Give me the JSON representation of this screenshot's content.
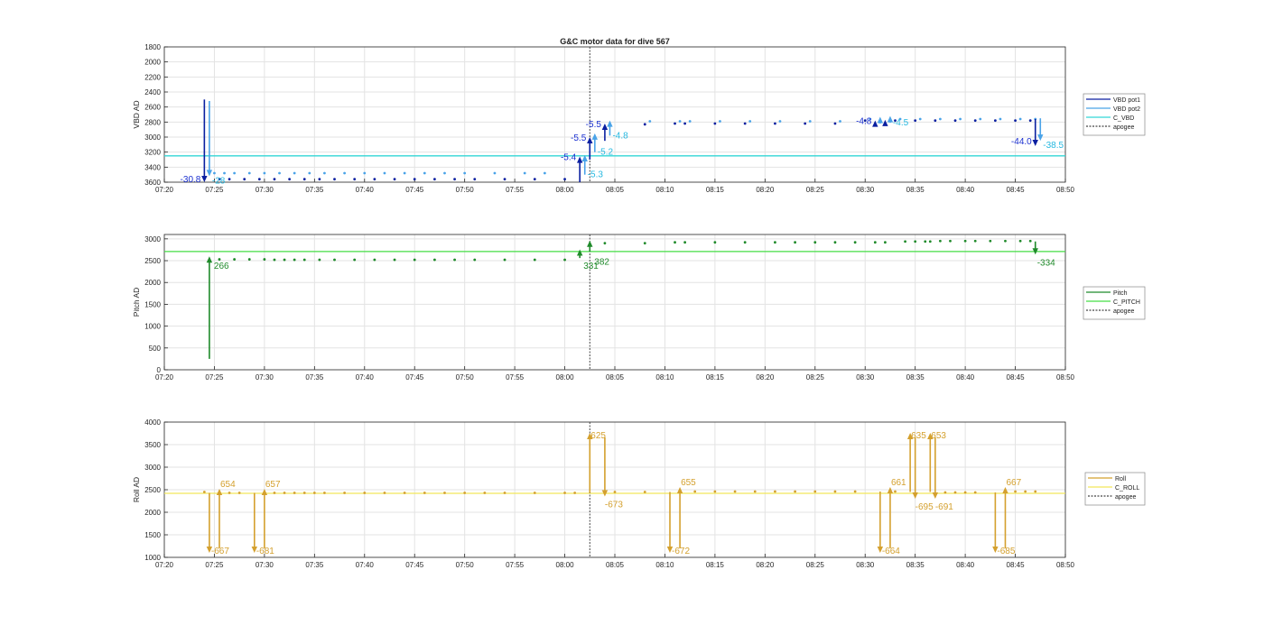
{
  "title": "G&C motor data for dive 567",
  "colors": {
    "vbd_pot1": "#0a1fa0",
    "vbd_pot2": "#4aa3e8",
    "c_vbd": "#33d6d6",
    "vbd_label1": "#1a2fd0",
    "vbd_label2": "#26b8e0",
    "pitch": "#1f8a2a",
    "c_pitch": "#44dd44",
    "roll": "#d4a02e",
    "c_roll": "#f2e85a",
    "apogee": "#444444",
    "grid": "#e3e3e3",
    "axis": "#262626"
  },
  "chart_data": [
    {
      "type": "line",
      "panel": "vbd",
      "title": "G&C motor data for dive 567",
      "xlabel": "",
      "ylabel": "VBD AD",
      "xlim": [
        "07:20",
        "08:50"
      ],
      "ylim": [
        1800,
        3600
      ],
      "y_reversed": true,
      "grid": true,
      "legend_position": "outside-right",
      "xticks": [
        "07:20",
        "07:25",
        "07:30",
        "07:35",
        "07:40",
        "07:45",
        "07:50",
        "07:55",
        "08:00",
        "08:05",
        "08:10",
        "08:15",
        "08:20",
        "08:25",
        "08:30",
        "08:35",
        "08:40",
        "08:45",
        "08:50"
      ],
      "yticks": [
        1800,
        2000,
        2200,
        2400,
        2600,
        2800,
        3000,
        3200,
        3400,
        3600
      ],
      "legend": [
        "VBD pot1",
        "VBD pot2",
        "C_VBD",
        "apogee"
      ],
      "hline": {
        "name": "C_VBD",
        "y": 3250
      },
      "apogee": "08:02.5",
      "series": [
        {
          "name": "VBD pot1",
          "x": [
            "07:25.5",
            "07:26.5",
            "07:28",
            "07:29.5",
            "07:31",
            "07:32.5",
            "07:34",
            "07:35.5",
            "07:37",
            "07:39",
            "07:41",
            "07:43",
            "07:45",
            "07:47",
            "07:49",
            "07:51",
            "07:54",
            "07:57",
            "08:00",
            "08:08",
            "08:11",
            "08:12",
            "08:15",
            "08:18",
            "08:21",
            "08:24",
            "08:27",
            "08:30",
            "08:33",
            "08:35",
            "08:37",
            "08:39",
            "08:41",
            "08:43",
            "08:45",
            "08:46.5"
          ],
          "y": [
            3560,
            3560,
            3560,
            3560,
            3560,
            3560,
            3560,
            3560,
            3560,
            3560,
            3560,
            3560,
            3560,
            3560,
            3560,
            3560,
            3560,
            3560,
            3560,
            2830,
            2820,
            2820,
            2820,
            2820,
            2820,
            2820,
            2820,
            2780,
            2780,
            2780,
            2780,
            2780,
            2780,
            2780,
            2780,
            2780
          ]
        },
        {
          "name": "VBD pot2",
          "x": [
            "07:25",
            "07:26",
            "07:27",
            "07:28.5",
            "07:30",
            "07:31.5",
            "07:33",
            "07:34.5",
            "07:36",
            "07:38",
            "07:40",
            "07:42",
            "07:44",
            "07:46",
            "07:48",
            "07:50",
            "07:53",
            "07:56",
            "07:58",
            "08:08.5",
            "08:11.5",
            "08:12.5",
            "08:15.5",
            "08:18.5",
            "08:21.5",
            "08:24.5",
            "08:27.5",
            "08:30.5",
            "08:33.5",
            "08:35.5",
            "08:37.5",
            "08:39.5",
            "08:41.5",
            "08:43.5",
            "08:45.5",
            "08:47"
          ],
          "y": [
            3480,
            3480,
            3480,
            3480,
            3480,
            3480,
            3480,
            3480,
            3480,
            3480,
            3480,
            3480,
            3480,
            3480,
            3480,
            3480,
            3480,
            3480,
            3480,
            2790,
            2790,
            2790,
            2790,
            2790,
            2790,
            2790,
            2790,
            2760,
            2760,
            2760,
            2760,
            2760,
            2760,
            2760,
            2760,
            2760
          ]
        }
      ],
      "arrows": [
        {
          "series": "VBD pot1",
          "x": "07:24",
          "y_from": 2500,
          "y_to": 3600,
          "label": "-30.8"
        },
        {
          "series": "VBD pot2",
          "x": "07:24.5",
          "y_from": 2520,
          "y_to": 3520,
          "label": "-28"
        },
        {
          "series": "VBD pot1",
          "x": "08:01.5",
          "y_from": 3600,
          "y_to": 3260,
          "label": "-5.4"
        },
        {
          "series": "VBD pot2",
          "x": "08:02",
          "y_from": 3500,
          "y_to": 3240,
          "label": "-5.3"
        },
        {
          "series": "VBD pot1",
          "x": "08:02.5",
          "y_from": 3300,
          "y_to": 3000,
          "label": "-5.5"
        },
        {
          "series": "VBD pot2",
          "x": "08:03",
          "y_from": 3200,
          "y_to": 2950,
          "label": "-5.2"
        },
        {
          "series": "VBD pot1",
          "x": "08:04",
          "y_from": 3050,
          "y_to": 2820,
          "label": "-5.5"
        },
        {
          "series": "VBD pot2",
          "x": "08:04.5",
          "y_from": 2980,
          "y_to": 2780,
          "label": "-4.8"
        },
        {
          "series": "VBD pot1",
          "x": "08:31",
          "y_from": 2850,
          "y_to": 2780,
          "label": "-4.8"
        },
        {
          "series": "VBD pot2",
          "x": "08:31.5",
          "y_from": 2820,
          "y_to": 2730,
          "label": ""
        },
        {
          "series": "VBD pot1",
          "x": "08:32",
          "y_from": 2840,
          "y_to": 2770,
          "label": ""
        },
        {
          "series": "VBD pot2",
          "x": "08:32.5",
          "y_from": 2810,
          "y_to": 2720,
          "label": "-4.5"
        },
        {
          "series": "VBD pot1",
          "x": "08:47",
          "y_from": 2760,
          "y_to": 3120,
          "label": "-44.0"
        },
        {
          "series": "VBD pot2",
          "x": "08:47.5",
          "y_from": 2750,
          "y_to": 3050,
          "label": "-38.5"
        }
      ]
    },
    {
      "type": "line",
      "panel": "pitch",
      "xlabel": "",
      "ylabel": "Pitch AD",
      "xlim": [
        "07:20",
        "08:50"
      ],
      "ylim": [
        0,
        3100
      ],
      "grid": true,
      "legend_position": "outside-right",
      "xticks": [
        "07:20",
        "07:25",
        "07:30",
        "07:35",
        "07:40",
        "07:45",
        "07:50",
        "07:55",
        "08:00",
        "08:05",
        "08:10",
        "08:15",
        "08:20",
        "08:25",
        "08:30",
        "08:35",
        "08:40",
        "08:45",
        "08:50"
      ],
      "yticks": [
        0,
        500,
        1000,
        1500,
        2000,
        2500,
        3000
      ],
      "legend": [
        "Pitch",
        "C_PITCH",
        "apogee"
      ],
      "hline": {
        "name": "C_PITCH",
        "y": 2710
      },
      "apogee": "08:02.5",
      "series": [
        {
          "name": "Pitch",
          "x": [
            "07:25.5",
            "07:27",
            "07:28.5",
            "07:30",
            "07:31",
            "07:32",
            "07:33",
            "07:34",
            "07:35.5",
            "07:37",
            "07:39",
            "07:41",
            "07:43",
            "07:45",
            "07:47",
            "07:49",
            "07:51",
            "07:54",
            "07:57",
            "08:00",
            "08:04",
            "08:08",
            "08:11",
            "08:12",
            "08:15",
            "08:18",
            "08:21",
            "08:23",
            "08:25",
            "08:27",
            "08:29",
            "08:31",
            "08:32",
            "08:34",
            "08:35",
            "08:36",
            "08:36.5",
            "08:37.5",
            "08:38.5",
            "08:40",
            "08:41",
            "08:42.5",
            "08:44",
            "08:45.5",
            "08:46.5"
          ],
          "y": [
            2530,
            2530,
            2530,
            2530,
            2520,
            2520,
            2520,
            2520,
            2520,
            2520,
            2520,
            2520,
            2520,
            2520,
            2520,
            2520,
            2520,
            2520,
            2520,
            2520,
            2900,
            2900,
            2920,
            2920,
            2920,
            2920,
            2920,
            2920,
            2920,
            2920,
            2920,
            2920,
            2920,
            2940,
            2940,
            2940,
            2940,
            2950,
            2950,
            2950,
            2950,
            2950,
            2950,
            2950,
            2950
          ]
        }
      ],
      "arrows": [
        {
          "series": "Pitch",
          "x": "07:24.5",
          "y_from": 250,
          "y_to": 2600,
          "label": "266"
        },
        {
          "series": "Pitch",
          "x": "08:01.5",
          "y_from": 2560,
          "y_to": 2760,
          "label": "331"
        },
        {
          "series": "Pitch",
          "x": "08:02.5",
          "y_from": 2700,
          "y_to": 2960,
          "label": "382"
        },
        {
          "series": "Pitch",
          "x": "08:47",
          "y_from": 2940,
          "y_to": 2640,
          "label": "-334"
        }
      ]
    },
    {
      "type": "line",
      "panel": "roll",
      "xlabel": "",
      "ylabel": "Roll AD",
      "xlim": [
        "07:20",
        "08:50"
      ],
      "ylim": [
        1000,
        4000
      ],
      "grid": true,
      "legend_position": "outside-right",
      "xticks": [
        "07:20",
        "07:25",
        "07:30",
        "07:35",
        "07:40",
        "07:45",
        "07:50",
        "07:55",
        "08:00",
        "08:05",
        "08:10",
        "08:15",
        "08:20",
        "08:25",
        "08:30",
        "08:35",
        "08:40",
        "08:45",
        "08:50"
      ],
      "yticks": [
        1000,
        1500,
        2000,
        2500,
        3000,
        3500,
        4000
      ],
      "legend": [
        "Roll",
        "C_ROLL",
        "apogee"
      ],
      "hline": {
        "name": "C_ROLL",
        "y": 2420
      },
      "apogee": "08:02.5",
      "series": [
        {
          "name": "Roll",
          "x": [
            "07:24",
            "07:26.5",
            "07:27.5",
            "07:31",
            "07:32",
            "07:33",
            "07:34",
            "07:35",
            "07:36",
            "07:38",
            "07:40",
            "07:42",
            "07:44",
            "07:46",
            "07:48",
            "07:50",
            "07:52",
            "07:54",
            "07:57",
            "08:00",
            "08:01",
            "08:05",
            "08:08",
            "08:13",
            "08:15",
            "08:17",
            "08:19",
            "08:21",
            "08:23",
            "08:25",
            "08:27",
            "08:29",
            "08:33",
            "08:38",
            "08:39",
            "08:40",
            "08:41",
            "08:45",
            "08:46",
            "08:47"
          ],
          "y": [
            2450,
            2430,
            2430,
            2430,
            2430,
            2430,
            2430,
            2430,
            2430,
            2430,
            2430,
            2430,
            2430,
            2430,
            2430,
            2430,
            2430,
            2430,
            2430,
            2430,
            2430,
            2450,
            2450,
            2460,
            2460,
            2460,
            2460,
            2460,
            2460,
            2460,
            2460,
            2460,
            2460,
            2440,
            2440,
            2440,
            2440,
            2460,
            2460,
            2460
          ]
        }
      ],
      "arrows": [
        {
          "series": "Roll",
          "x": "07:24.5",
          "y_from": 2430,
          "y_to": 1100,
          "label": "-667"
        },
        {
          "series": "Roll",
          "x": "07:25.5",
          "y_from": 1200,
          "y_to": 2520,
          "label": "654"
        },
        {
          "series": "Roll",
          "x": "07:29",
          "y_from": 2430,
          "y_to": 1100,
          "label": "-681"
        },
        {
          "series": "Roll",
          "x": "07:30",
          "y_from": 1200,
          "y_to": 2520,
          "label": "657"
        },
        {
          "series": "Roll",
          "x": "08:02.5",
          "y_from": 2430,
          "y_to": 3760,
          "label": "625"
        },
        {
          "series": "Roll",
          "x": "08:04",
          "y_from": 3660,
          "y_to": 2350,
          "label": "-673"
        },
        {
          "series": "Roll",
          "x": "08:10.5",
          "y_from": 2450,
          "y_to": 1100,
          "label": "-672"
        },
        {
          "series": "Roll",
          "x": "08:11.5",
          "y_from": 1200,
          "y_to": 2560,
          "label": "655"
        },
        {
          "series": "Roll",
          "x": "08:31.5",
          "y_from": 2460,
          "y_to": 1100,
          "label": "-664"
        },
        {
          "series": "Roll",
          "x": "08:32.5",
          "y_from": 1200,
          "y_to": 2560,
          "label": "661"
        },
        {
          "series": "Roll",
          "x": "08:34.5",
          "y_from": 2450,
          "y_to": 3760,
          "label": "635"
        },
        {
          "series": "Roll",
          "x": "08:35",
          "y_from": 3660,
          "y_to": 2300,
          "label": "-695"
        },
        {
          "series": "Roll",
          "x": "08:36.5",
          "y_from": 2450,
          "y_to": 3760,
          "label": "653"
        },
        {
          "series": "Roll",
          "x": "08:37",
          "y_from": 3660,
          "y_to": 2300,
          "label": "-691"
        },
        {
          "series": "Roll",
          "x": "08:43",
          "y_from": 2440,
          "y_to": 1100,
          "label": "-685"
        },
        {
          "series": "Roll",
          "x": "08:44",
          "y_from": 1200,
          "y_to": 2560,
          "label": "667"
        }
      ]
    }
  ]
}
